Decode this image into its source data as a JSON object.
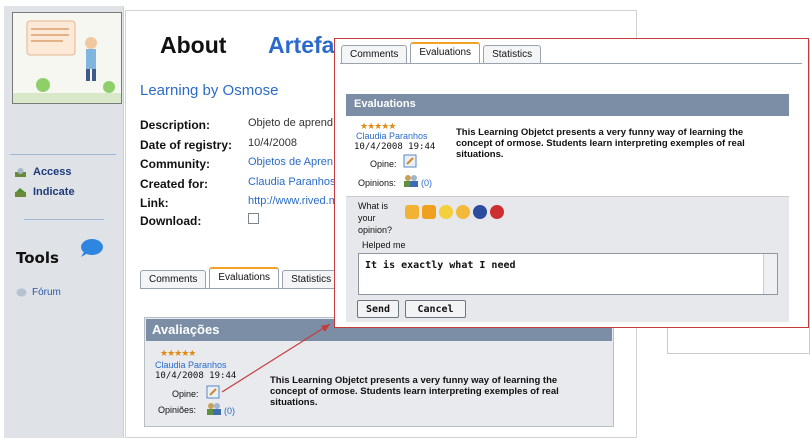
{
  "about": {
    "title": "About",
    "accent": "Artefa",
    "subtitle": "Learning by Osmose"
  },
  "sidebar": {
    "access": "Access",
    "indicate": "Indicate",
    "tools_title": "Tools",
    "forum": "Fórum"
  },
  "details": {
    "description_label": "Description:",
    "description_value": "Objeto de aprend",
    "date_label": "Date of registry:",
    "date_value": "10/4/2008",
    "community_label": "Community:",
    "community_value": "Objetos de Apren",
    "created_label": "Created for:",
    "created_value": "Claudia Paranhos",
    "link_label": "Link:",
    "link_value": "http://www.rived.m",
    "download_label": "Download:"
  },
  "bg_tabs": {
    "comments": "Comments",
    "evaluations": "Evaluations",
    "statistics": "Statistics"
  },
  "bg_eval": {
    "header": "Avaliações",
    "stars": "★★★★★",
    "name": "Claudia Paranhos",
    "date": "10/4/2008 19:44",
    "opine_label": "Opine:",
    "opinions_label": "Opiniões:",
    "count": "(0)",
    "text": "This Learning Objetct presents a very funny way of learning the concept of ormose. Students learn interpreting exemples of real situations."
  },
  "popup": {
    "tabs": {
      "comments": "Comments",
      "evaluations": "Evaluations",
      "statistics": "Statistics"
    },
    "header": "Evaluations",
    "stars": "★★★★★",
    "name": "Claudia Paranhos",
    "date": "10/4/2008 19:44",
    "opine_label": "Opine:",
    "opinions_label": "Opinions:",
    "count": "(0)",
    "text": "This Learning Objetct presents a very funny way of learning the concept of ormose. Students learn interpreting exemples of real situations.",
    "question_1": "What is",
    "question_2": "your",
    "question_3": "opinion?",
    "selected_opinion": "Helped me",
    "reply_text": "It is exactly what I need",
    "send_label": "Send",
    "cancel_label": "Cancel"
  },
  "colors": {
    "accent": "#2a6bc9",
    "header_bg": "#7b8ea6",
    "tab_highlight": "#f0a326",
    "callout": "#c53b3b"
  }
}
